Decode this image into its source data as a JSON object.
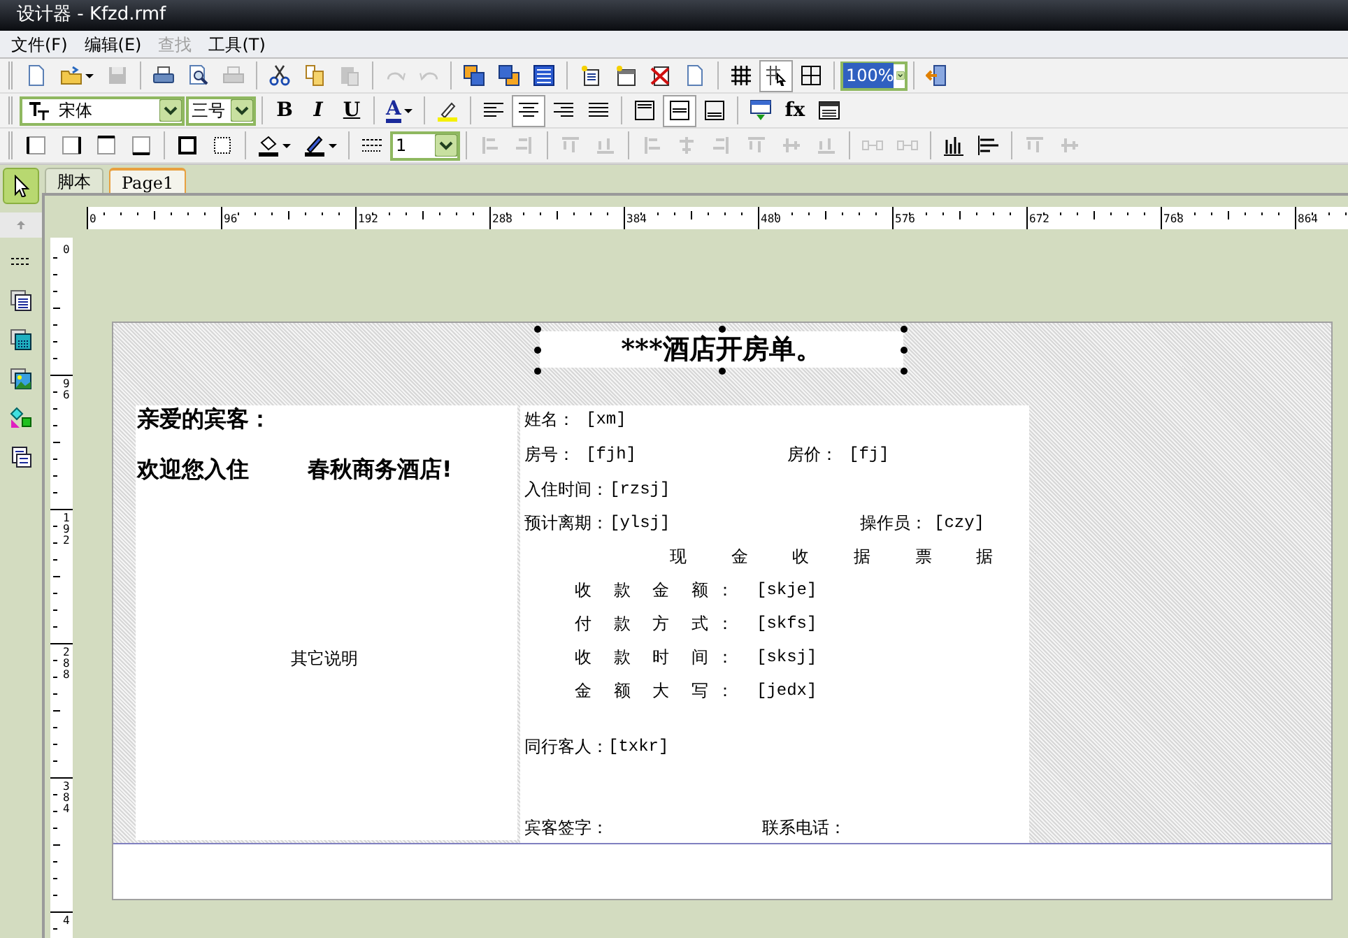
{
  "window": {
    "title": "设计器 - Kfzd.rmf"
  },
  "menu": [
    {
      "label": "文件(F)",
      "disabled": false
    },
    {
      "label": "编辑(E)",
      "disabled": false
    },
    {
      "label": "查找",
      "disabled": true
    },
    {
      "label": "工具(T)",
      "disabled": false
    }
  ],
  "toolbars": [
    [
      {
        "kind": "button",
        "disabled": false,
        "pressed": false
      },
      {
        "kind": "split-button",
        "disabled": false,
        "pressed": false
      },
      {
        "kind": "button",
        "disabled": true,
        "pressed": false
      },
      {
        "kind": "separator"
      },
      {
        "kind": "button",
        "disabled": false,
        "pressed": false
      },
      {
        "kind": "button",
        "disabled": false,
        "pressed": false
      },
      {
        "kind": "button",
        "disabled": true,
        "pressed": false
      },
      {
        "kind": "separator"
      },
      {
        "kind": "button",
        "disabled": false,
        "pressed": false
      },
      {
        "kind": "button",
        "disabled": false,
        "pressed": false
      },
      {
        "kind": "button",
        "disabled": true,
        "pressed": false
      },
      {
        "kind": "separator"
      },
      {
        "kind": "button",
        "disabled": true,
        "pressed": false
      },
      {
        "kind": "button",
        "disabled": true,
        "pressed": false
      },
      {
        "kind": "separator"
      },
      {
        "kind": "button",
        "disabled": false,
        "pressed": false
      },
      {
        "kind": "button",
        "disabled": false,
        "pressed": false
      },
      {
        "kind": "button",
        "disabled": false,
        "pressed": false
      },
      {
        "kind": "separator"
      },
      {
        "kind": "button",
        "disabled": false,
        "pressed": false
      },
      {
        "kind": "button",
        "disabled": false,
        "pressed": false
      },
      {
        "kind": "button",
        "disabled": false,
        "pressed": false
      },
      {
        "kind": "button",
        "disabled": false,
        "pressed": false
      },
      {
        "kind": "separator"
      },
      {
        "kind": "button",
        "disabled": false,
        "pressed": false
      },
      {
        "kind": "button",
        "disabled": false,
        "pressed": true
      },
      {
        "kind": "button",
        "disabled": false,
        "pressed": false
      },
      {
        "kind": "separator"
      },
      {
        "kind": "combo",
        "value": "100%"
      },
      {
        "kind": "separator"
      },
      {
        "kind": "button",
        "disabled": false,
        "pressed": false
      }
    ],
    [
      {
        "kind": "font-combo",
        "value": "宋体"
      },
      {
        "kind": "combo",
        "value": "三号"
      },
      {
        "kind": "separator"
      },
      {
        "kind": "text-button",
        "text": "B",
        "disabled": false,
        "pressed": false
      },
      {
        "kind": "text-button",
        "text": "I",
        "disabled": false,
        "pressed": false
      },
      {
        "kind": "text-button",
        "text": "U",
        "disabled": false,
        "pressed": false
      },
      {
        "kind": "separator"
      },
      {
        "kind": "split-text-button",
        "text": "A",
        "disabled": false,
        "pressed": false
      },
      {
        "kind": "separator"
      },
      {
        "kind": "button",
        "disabled": false,
        "pressed": false
      },
      {
        "kind": "separator"
      },
      {
        "kind": "button",
        "disabled": false,
        "pressed": false
      },
      {
        "kind": "button",
        "disabled": false,
        "pressed": true
      },
      {
        "kind": "button",
        "disabled": false,
        "pressed": false
      },
      {
        "kind": "button",
        "disabled": false,
        "pressed": false
      },
      {
        "kind": "separator"
      },
      {
        "kind": "button",
        "disabled": false,
        "pressed": false
      },
      {
        "kind": "button",
        "disabled": false,
        "pressed": true
      },
      {
        "kind": "button",
        "disabled": false,
        "pressed": false
      },
      {
        "kind": "separator"
      },
      {
        "kind": "button",
        "disabled": false,
        "pressed": false
      },
      {
        "kind": "text-button",
        "text": "fx",
        "disabled": false,
        "pressed": false
      },
      {
        "kind": "button",
        "disabled": false,
        "pressed": false
      }
    ],
    [
      {
        "kind": "button",
        "disabled": false,
        "pressed": false
      },
      {
        "kind": "button",
        "disabled": false,
        "pressed": false
      },
      {
        "kind": "button",
        "disabled": false,
        "pressed": false
      },
      {
        "kind": "button",
        "disabled": false,
        "pressed": false
      },
      {
        "kind": "separator"
      },
      {
        "kind": "button",
        "disabled": false,
        "pressed": false
      },
      {
        "kind": "button",
        "disabled": false,
        "pressed": false
      },
      {
        "kind": "separator"
      },
      {
        "kind": "split-button",
        "disabled": false,
        "pressed": false
      },
      {
        "kind": "split-button",
        "disabled": false,
        "pressed": false
      },
      {
        "kind": "separator"
      },
      {
        "kind": "button",
        "disabled": false,
        "pressed": false
      },
      {
        "kind": "combo",
        "value": "1"
      },
      {
        "kind": "separator"
      },
      {
        "kind": "button",
        "disabled": true,
        "pressed": false
      },
      {
        "kind": "button",
        "disabled": true,
        "pressed": false
      },
      {
        "kind": "separator"
      },
      {
        "kind": "button",
        "disabled": true,
        "pressed": false
      },
      {
        "kind": "button",
        "disabled": true,
        "pressed": false
      },
      {
        "kind": "separator"
      },
      {
        "kind": "button",
        "disabled": true,
        "pressed": false
      },
      {
        "kind": "button",
        "disabled": true,
        "pressed": false
      },
      {
        "kind": "button",
        "disabled": true,
        "pressed": false
      },
      {
        "kind": "button",
        "disabled": true,
        "pressed": false
      },
      {
        "kind": "button",
        "disabled": true,
        "pressed": false
      },
      {
        "kind": "button",
        "disabled": true,
        "pressed": false
      },
      {
        "kind": "separator"
      },
      {
        "kind": "button",
        "disabled": true,
        "pressed": false
      },
      {
        "kind": "button",
        "disabled": true,
        "pressed": false
      },
      {
        "kind": "separator"
      },
      {
        "kind": "button",
        "disabled": false,
        "pressed": false
      },
      {
        "kind": "button",
        "disabled": false,
        "pressed": false
      },
      {
        "kind": "separator"
      },
      {
        "kind": "button",
        "disabled": true,
        "pressed": false
      },
      {
        "kind": "button",
        "disabled": true,
        "pressed": false
      }
    ]
  ],
  "toolbox": [
    {
      "selected": true
    },
    {
      "selected": false
    },
    {
      "selected": false
    },
    {
      "selected": false
    },
    {
      "selected": false
    },
    {
      "selected": false
    },
    {
      "selected": false
    }
  ],
  "tabs": [
    {
      "label": "脚本",
      "selected": false
    },
    {
      "label": "Page1",
      "selected": true
    }
  ],
  "ruler": {
    "horizontal": [
      "0",
      "96",
      "192",
      "288",
      "384",
      "480",
      "576",
      "672",
      "768",
      "864"
    ],
    "vertical": [
      "0",
      "96",
      "192",
      "288",
      "384",
      "4"
    ]
  },
  "report": {
    "title": "***酒店开房单。",
    "left_panel": [
      {
        "kind": "heading",
        "text": "亲爱的宾客："
      },
      {
        "kind": "heading",
        "text": "欢迎您入住"
      },
      {
        "kind": "heading",
        "text": "春秋商务酒店!"
      },
      {
        "kind": "label",
        "text": "其它说明"
      }
    ],
    "right_panel": [
      {
        "kind": "label",
        "text": "姓名："
      },
      {
        "kind": "field",
        "text": "[xm]"
      },
      {
        "kind": "label",
        "text": "房号："
      },
      {
        "kind": "field",
        "text": "[fjh]"
      },
      {
        "kind": "label",
        "text": "房价："
      },
      {
        "kind": "field",
        "text": "[fj]"
      },
      {
        "kind": "label",
        "text": "入住时间："
      },
      {
        "kind": "field",
        "text": "[rzsj]"
      },
      {
        "kind": "label",
        "text": "预计离期："
      },
      {
        "kind": "field",
        "text": "[ylsj]"
      },
      {
        "kind": "label",
        "text": "操作员："
      },
      {
        "kind": "field",
        "text": "[czy]"
      },
      {
        "kind": "section",
        "text": "现 金 收 据 票 据"
      },
      {
        "kind": "spaced-label",
        "text": "收 款 金 额："
      },
      {
        "kind": "field",
        "text": "[skje]"
      },
      {
        "kind": "spaced-label",
        "text": "付 款 方 式："
      },
      {
        "kind": "field",
        "text": "[skfs]"
      },
      {
        "kind": "spaced-label",
        "text": "收 款 时 间："
      },
      {
        "kind": "field",
        "text": "[sksj]"
      },
      {
        "kind": "spaced-label",
        "text": "金 额 大 写："
      },
      {
        "kind": "field",
        "text": "[jedx]"
      },
      {
        "kind": "label",
        "text": "同行客人："
      },
      {
        "kind": "field",
        "text": "[txkr]"
      },
      {
        "kind": "label",
        "text": "宾客签字："
      },
      {
        "kind": "label",
        "text": "联系电话："
      }
    ]
  }
}
